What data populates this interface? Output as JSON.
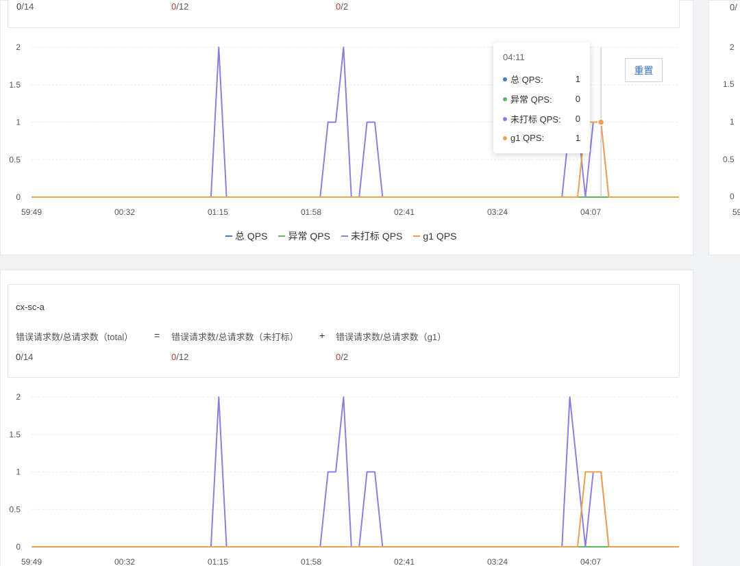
{
  "panels": [
    {
      "id": "panel1",
      "name": "",
      "formula": {
        "total_label": "",
        "eq": "",
        "untagged_label": "",
        "plus": "",
        "g1_label": ""
      },
      "values": {
        "total_num": "0",
        "total_den": "/14",
        "untagged_num": "0",
        "untagged_den": "/12",
        "g1_num": "0",
        "g1_den": "/2"
      }
    },
    {
      "id": "panel2",
      "name": "cx-sc-a",
      "formula": {
        "total_label": "错误请求数/总请求数（total）",
        "eq": "=",
        "untagged_label": "错误请求数/总请求数（未打标）",
        "plus": "+",
        "g1_label": "错误请求数/总请求数（g1）"
      },
      "values": {
        "total_num": "0",
        "total_den": "/14",
        "untagged_num": "0",
        "untagged_den": "/12",
        "g1_num": "0",
        "g1_den": "/2"
      }
    }
  ],
  "chart_data": [
    {
      "type": "line",
      "title": "",
      "ylim": [
        0,
        2
      ],
      "yticks": [
        "2",
        "1.5",
        "1",
        "0.5",
        "0"
      ],
      "ytick_values": [
        2,
        1.5,
        1,
        0.5,
        0
      ],
      "xticks": [
        "59:49",
        "00:32",
        "01:15",
        "01:58",
        "02:41",
        "03:24",
        "04:07"
      ],
      "n_points": 83,
      "series": [
        {
          "name": "总 QPS",
          "color": "#3f7cc4",
          "pulses": []
        },
        {
          "name": "异常 QPS",
          "color": "#5cb85c",
          "pulses": []
        },
        {
          "name": "未打标 QPS",
          "color": "#8a7fe0",
          "pulses": [
            [
              24,
              2
            ],
            [
              38,
              1
            ],
            [
              39,
              1
            ],
            [
              40,
              2
            ],
            [
              43,
              1
            ],
            [
              44,
              1
            ],
            [
              69,
              1
            ],
            [
              70,
              1
            ],
            [
              72,
              1
            ],
            [
              73,
              1
            ]
          ]
        },
        {
          "name": "g1 QPS",
          "color": "#efa04e",
          "pulses": [
            [
              71,
              1
            ],
            [
              72,
              1
            ],
            [
              73,
              1
            ]
          ]
        }
      ],
      "legend": "bottom",
      "hover": {
        "index": 73,
        "x_label": "04:11"
      }
    },
    {
      "type": "line",
      "title": "",
      "ylim": [
        0,
        2
      ],
      "yticks": [
        "2",
        "1.5",
        "1",
        "0.5",
        "0"
      ],
      "ytick_values": [
        2,
        1.5,
        1,
        0.5,
        0
      ],
      "xticks": [
        "59:49",
        "00:32",
        "01:15",
        "01:58",
        "02:41",
        "03:24",
        "04:07"
      ],
      "n_points": 83,
      "series": [
        {
          "name": "总 QPS",
          "color": "#3f7cc4",
          "pulses": []
        },
        {
          "name": "异常 QPS",
          "color": "#5cb85c",
          "pulses": []
        },
        {
          "name": "未打标 QPS",
          "color": "#8a7fe0",
          "pulses": [
            [
              24,
              2
            ],
            [
              38,
              1
            ],
            [
              39,
              1
            ],
            [
              40,
              2
            ],
            [
              43,
              1
            ],
            [
              44,
              1
            ],
            [
              69,
              2
            ],
            [
              70,
              1
            ],
            [
              72,
              1
            ],
            [
              73,
              1
            ]
          ]
        },
        {
          "name": "g1 QPS",
          "color": "#efa04e",
          "pulses": [
            [
              71,
              1
            ],
            [
              72,
              1
            ],
            [
              73,
              1
            ]
          ]
        }
      ]
    }
  ],
  "tooltip": {
    "title": "04:11",
    "rows": [
      {
        "name": "总 QPS:",
        "value": "1",
        "color": "#3f7cc4"
      },
      {
        "name": "异常 QPS:",
        "value": "0",
        "color": "#5cb85c"
      },
      {
        "name": "未打标 QPS:",
        "value": "0",
        "color": "#8a7fe0"
      },
      {
        "name": "g1 QPS:",
        "value": "1",
        "color": "#efa04e"
      }
    ]
  },
  "reset_button": {
    "label": "重置"
  },
  "right_panel": {
    "values": {
      "total_num": "0",
      "total_den": "/"
    },
    "yticks": [
      "2",
      "1.5",
      "1",
      "0.5",
      "0"
    ],
    "xtick_partial": "59"
  }
}
